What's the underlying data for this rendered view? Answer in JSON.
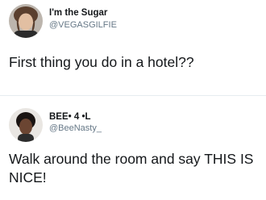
{
  "tweets": [
    {
      "display_name": "I'm the Sugar",
      "handle": "@VEGASGILFIE",
      "text": "First thing you do in a hotel??"
    },
    {
      "display_name": "BEE• 4 •L",
      "handle": "@BeeNasty_",
      "text": "Walk around the room and say THIS IS NICE!"
    }
  ],
  "colors": {
    "text": "#14171a",
    "handle": "#657786",
    "background": "#ffffff"
  }
}
